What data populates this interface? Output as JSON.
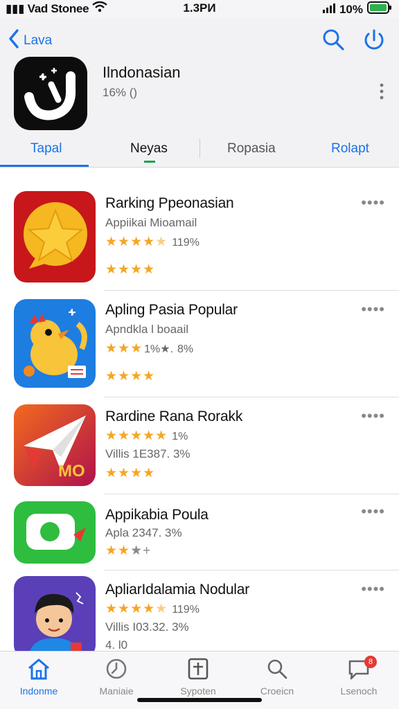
{
  "status": {
    "carrier": "Vad Stonee",
    "time": "1.3PИ",
    "battery": "10%"
  },
  "header": {
    "back_label": "Lava",
    "app_name": "Ilndonasian",
    "app_sub": "16% ()"
  },
  "tabs": [
    "Tapal",
    "Neyas",
    "Ropasia",
    "Rolapt"
  ],
  "apps": [
    {
      "title": "Rarking Ppeonasian",
      "line1": "Appiikai Mioamail",
      "stars1": "★★★★",
      "half1": "★",
      "pct1": "119%",
      "stars2": "★★★★",
      "icon": "star-bubble-icon"
    },
    {
      "title": "Apling Pasia Popular",
      "line1": "Apndkla l boaail",
      "stars1": "★★★",
      "half1": "1%★.",
      "pct1": "8%",
      "stars2": "★★★★",
      "icon": "bird-mascot-icon"
    },
    {
      "title": "Rardine Rana Rorakk",
      "stars1": "★★★★★",
      "pct1": "1%",
      "line2": "Villis 1E387. 3%",
      "stars2": "★★★★",
      "icon": "paper-plane-icon"
    },
    {
      "title": "Appikabia Poula",
      "line1": "Apla 2347. 3%",
      "stars1": "★★",
      "gray1": "★+",
      "icon": "chat-bubble-icon"
    },
    {
      "title": "ApliarIdalamia Nodular",
      "stars1": "★★★★",
      "half1": "★",
      "pct1": "119%",
      "line2": "Villis I03.32. 3%",
      "line3": "4. l0",
      "icon": "avatar-boy-icon"
    }
  ],
  "bottom_tabs": [
    {
      "label": "Indonme",
      "icon": "home-icon"
    },
    {
      "label": "Maniaie",
      "icon": "clock-icon"
    },
    {
      "label": "Sypoten",
      "icon": "plus-box-icon"
    },
    {
      "label": "Croeicn",
      "icon": "search-icon"
    },
    {
      "label": "Lsenoch",
      "icon": "chat-icon",
      "badge": "8"
    }
  ],
  "colors": {
    "accent": "#1a73e8",
    "star": "#f5a623",
    "badge": "#e53935"
  }
}
